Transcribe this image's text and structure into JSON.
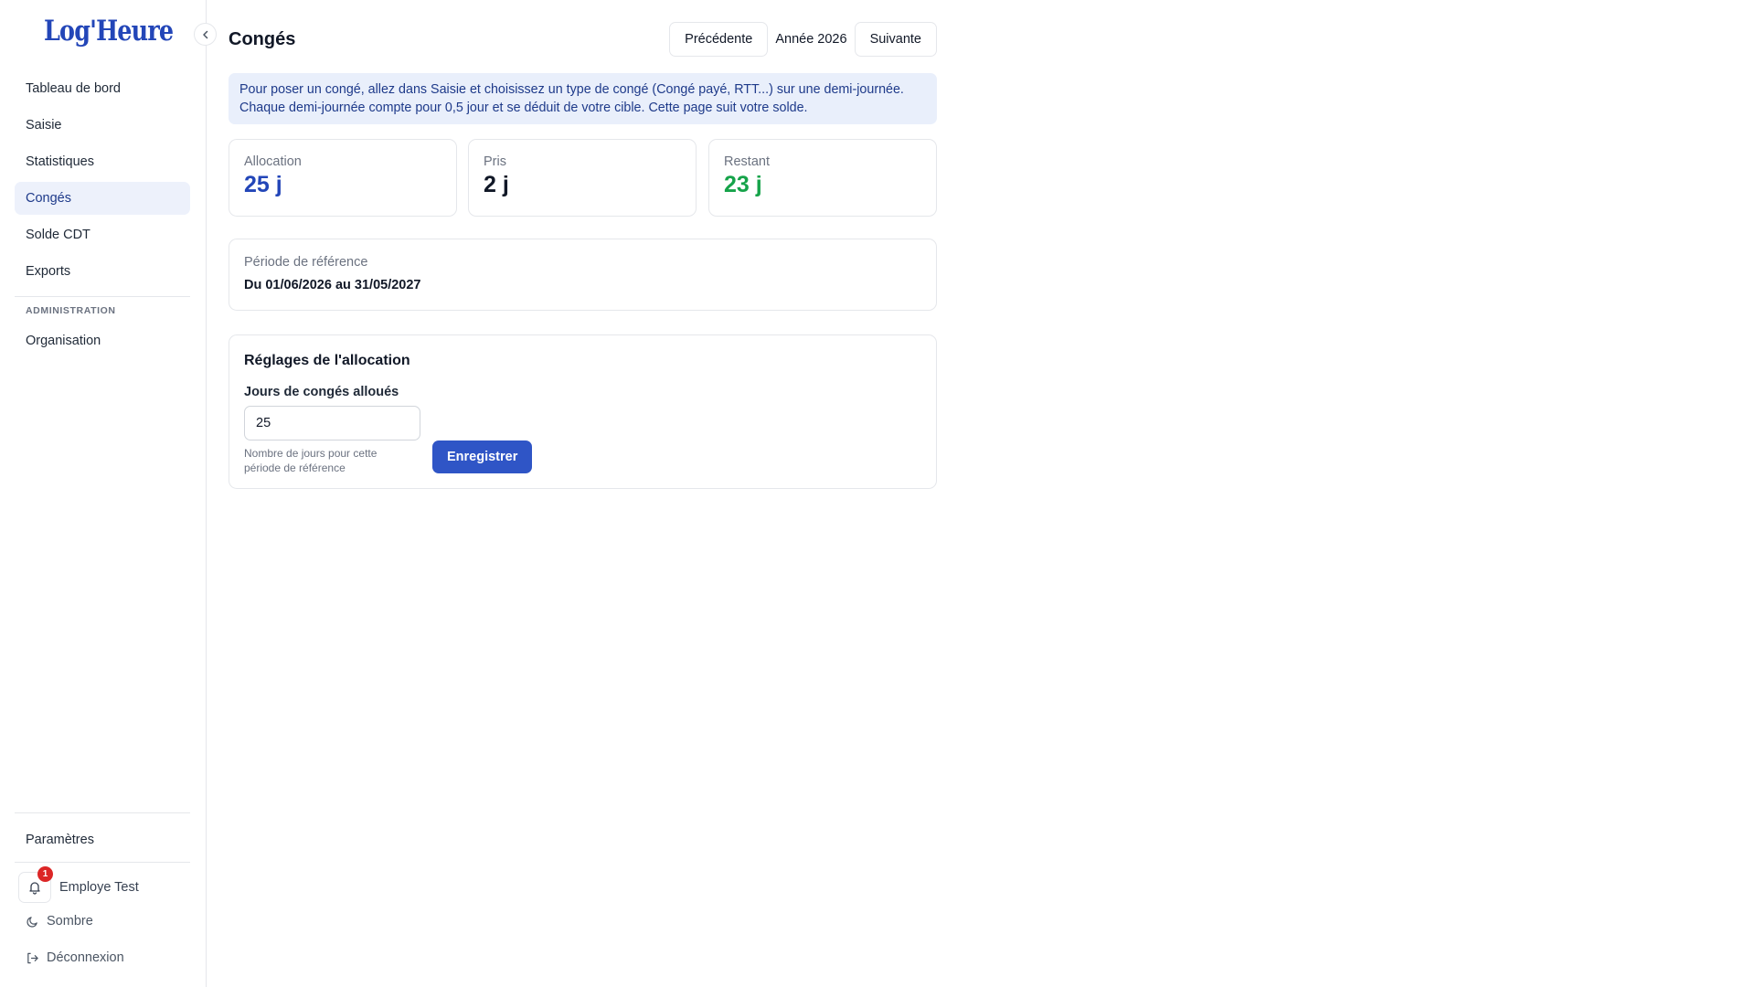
{
  "app": {
    "logo": "Log'Heure"
  },
  "sidebar": {
    "items": [
      {
        "label": "Tableau de bord"
      },
      {
        "label": "Saisie"
      },
      {
        "label": "Statistiques"
      },
      {
        "label": "Congés",
        "active": true
      },
      {
        "label": "Solde CDT"
      },
      {
        "label": "Exports"
      }
    ],
    "section_admin": "ADMINISTRATION",
    "admin_items": [
      {
        "label": "Organisation"
      }
    ],
    "settings_label": "Paramètres",
    "notifications_count": "1",
    "user_name": "Employe Test",
    "theme_label": "Sombre",
    "logout_label": "Déconnexion"
  },
  "header": {
    "title": "Congés",
    "prev_label": "Précédente",
    "year_label": "Année 2026",
    "next_label": "Suivante"
  },
  "info": {
    "text": "Pour poser un congé, allez dans Saisie et choisissez un type de congé (Congé payé, RTT...) sur une demi-journée. Chaque demi-journée compte pour 0,5 jour et se déduit de votre cible. Cette page suit votre solde."
  },
  "stats": [
    {
      "label": "Allocation",
      "value": "25 j",
      "color": "#2346b8"
    },
    {
      "label": "Pris",
      "value": "2 j",
      "color": "#111827"
    },
    {
      "label": "Restant",
      "value": "23 j",
      "color": "#16a34a"
    }
  ],
  "reference": {
    "label": "Période de référence",
    "value": "Du 01/06/2026 au 31/05/2027"
  },
  "settings": {
    "title": "Réglages de l'allocation",
    "field_label": "Jours de congés alloués",
    "field_value": "25",
    "field_help": "Nombre de jours pour cette période de référence",
    "save_label": "Enregistrer"
  },
  "colors": {
    "accent": "#2f55c6",
    "brand": "#2346b8",
    "success": "#16a34a",
    "danger": "#dc2626",
    "info_bg": "#e9effb"
  }
}
